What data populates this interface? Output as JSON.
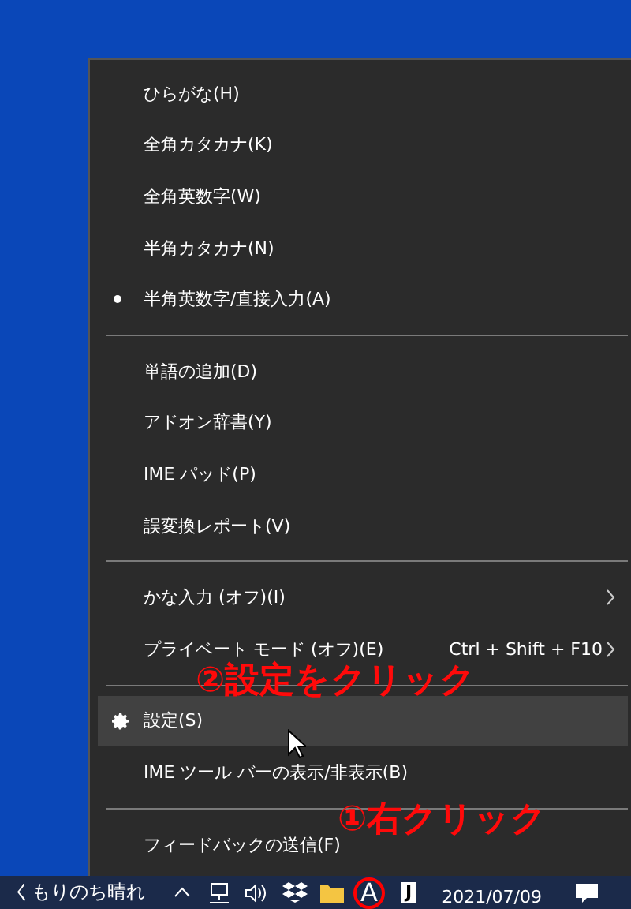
{
  "context_menu": {
    "sections": [
      {
        "items": [
          {
            "kind": "option",
            "label": "ひらがな(H)",
            "selected": false
          },
          {
            "kind": "option",
            "label": "全角カタカナ(K)",
            "selected": false
          },
          {
            "kind": "option",
            "label": "全角英数字(W)",
            "selected": false
          },
          {
            "kind": "option",
            "label": "半角カタカナ(N)",
            "selected": false
          },
          {
            "kind": "option",
            "label": "半角英数字/直接入力(A)",
            "selected": true
          }
        ]
      },
      {
        "items": [
          {
            "kind": "command",
            "label": "単語の追加(D)",
            "highlighted": false
          },
          {
            "kind": "command",
            "label": "アドオン辞書(Y)",
            "highlighted": false
          },
          {
            "kind": "command",
            "label": "IME パッド(P)",
            "highlighted": false
          },
          {
            "kind": "command",
            "label": "誤変換レポート(V)",
            "highlighted": false
          }
        ]
      },
      {
        "items": [
          {
            "kind": "submenu",
            "label": "かな入力 (オフ)(I)"
          },
          {
            "kind": "submenu",
            "label": "プライベート モード (オフ)(E)",
            "shortcut": "Ctrl + Shift + F10"
          }
        ]
      },
      {
        "items": [
          {
            "kind": "settings",
            "label": "設定(S)",
            "highlighted": true
          },
          {
            "kind": "command",
            "label": "IME ツール バーの表示/非表示(B)",
            "highlighted": false
          }
        ]
      },
      {
        "items": [
          {
            "kind": "command",
            "label": "フィードバックの送信(F)",
            "highlighted": false
          }
        ]
      }
    ]
  },
  "annotations": [
    {
      "text": "②設定をクリック"
    },
    {
      "text": "①右クリック"
    }
  ],
  "taskbar": {
    "weather": "くもりのち晴れ",
    "ime_mode": "A",
    "ime_alt": "J",
    "date": "2021/07/09"
  }
}
